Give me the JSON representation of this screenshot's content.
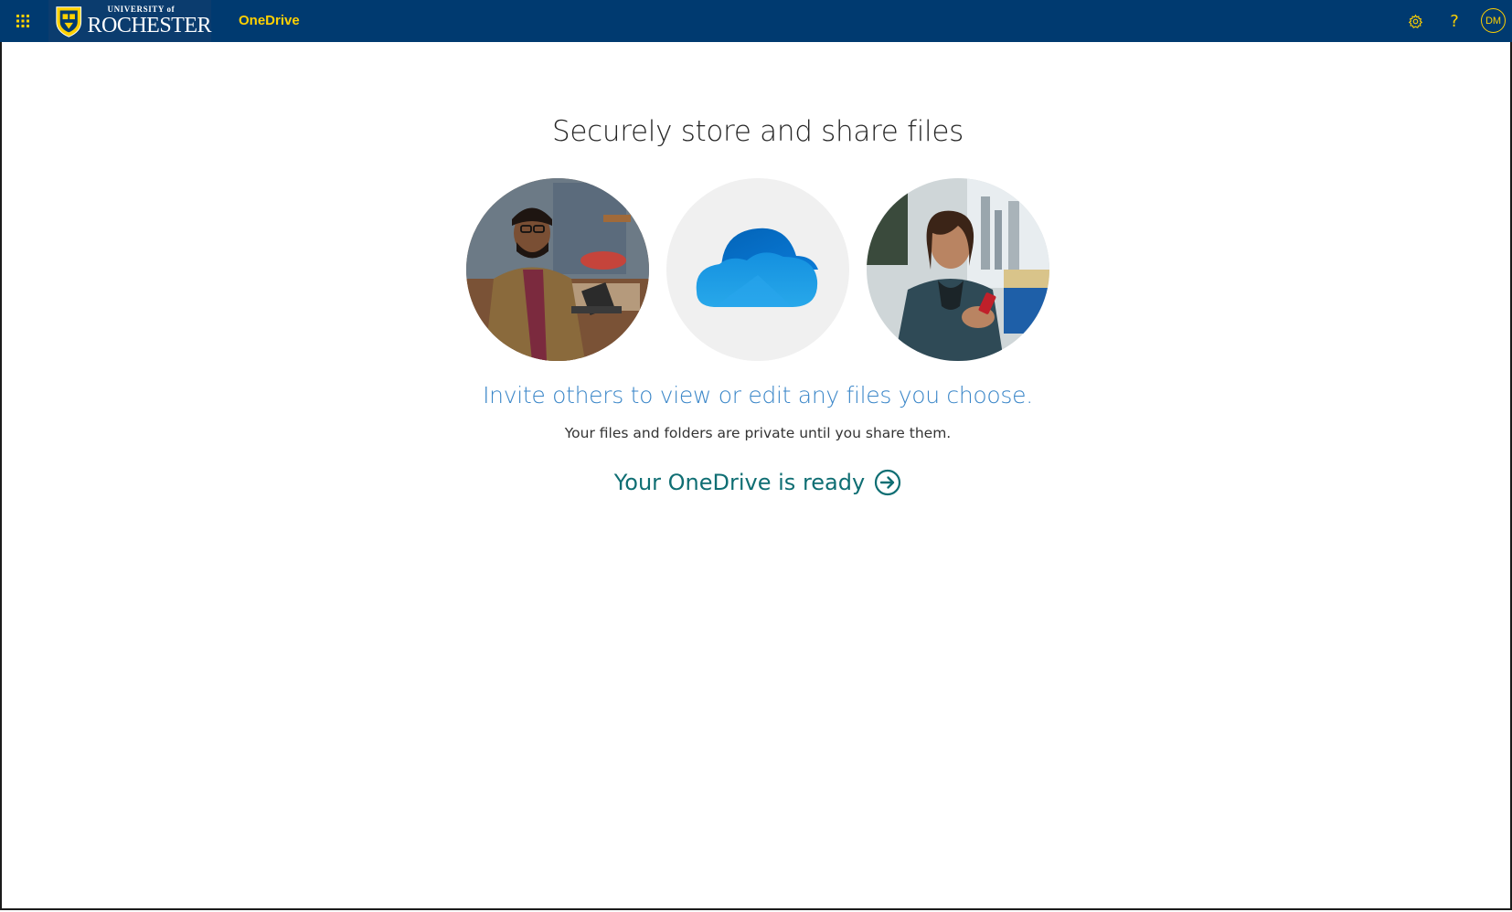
{
  "suite_bar": {
    "waffle_icon": "app-launcher-icon",
    "brand": {
      "small_text": "UNIVERSITY of",
      "big_text": "ROCHESTER"
    },
    "app_name": "OneDrive",
    "settings_icon": "gear-icon",
    "help_label": "?",
    "avatar_initials": "DM",
    "colors": {
      "bar": "#003a70",
      "accent": "#ffd100"
    }
  },
  "main": {
    "headline": "Securely store and share files",
    "images": [
      {
        "name": "man-working-photo"
      },
      {
        "name": "onedrive-cloud-logo"
      },
      {
        "name": "woman-with-phone-photo"
      }
    ],
    "subheadline": "Invite others to view or edit any files you choose.",
    "description": "Your files and folders are private until you share them.",
    "cta": {
      "label": "Your OneDrive is ready",
      "icon": "arrow-right-circle-icon"
    },
    "colors": {
      "subheadline": "#3a86c8",
      "cta": "#0f6e73"
    }
  }
}
